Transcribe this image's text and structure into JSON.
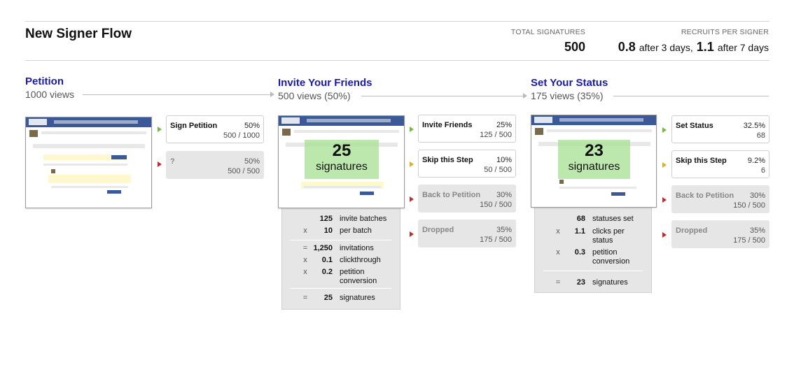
{
  "header": {
    "title": "New Signer Flow",
    "total_signatures_label": "TOTAL SIGNATURES",
    "total_signatures_value": "500",
    "recruits_label": "RECRUITS PER SIGNER",
    "recruits_3d_value": "0.8",
    "recruits_3d_text": "after 3 days,",
    "recruits_7d_value": "1.1",
    "recruits_7d_text": "after 7 days"
  },
  "stages": [
    {
      "title": "Petition",
      "views": "1000 views",
      "options": [
        {
          "label": "Sign Petition",
          "pct": "50%",
          "frac": "500 / 1000",
          "state": "green"
        },
        {
          "label": "?",
          "pct": "50%",
          "frac": "500 / 500",
          "state": "red"
        }
      ]
    },
    {
      "title": "Invite Your Friends",
      "views": "500 views (50%)",
      "overlay_num": "25",
      "overlay_label": "signatures",
      "options": [
        {
          "label": "Invite Friends",
          "pct": "25%",
          "frac": "125 / 500",
          "state": "green"
        },
        {
          "label": "Skip this Step",
          "pct": "10%",
          "frac": "50 / 500",
          "state": "yellow"
        },
        {
          "label": "Back to Petition",
          "pct": "30%",
          "frac": "150 / 500",
          "state": "red"
        },
        {
          "label": "Dropped",
          "pct": "35%",
          "frac": "175 / 500",
          "state": "red"
        }
      ],
      "calc": [
        {
          "op": "",
          "val": "125",
          "desc": "invite batches"
        },
        {
          "op": "x",
          "val": "10",
          "desc": "per batch"
        },
        {
          "op": "=",
          "val": "1,250",
          "desc": "invitations"
        },
        {
          "op": "x",
          "val": "0.1",
          "desc": "clickthrough"
        },
        {
          "op": "x",
          "val": "0.2",
          "desc": "petition conversion"
        },
        {
          "op": "=",
          "val": "25",
          "desc": "signatures"
        }
      ]
    },
    {
      "title": "Set Your Status",
      "views": "175 views (35%)",
      "overlay_num": "23",
      "overlay_label": "signatures",
      "options": [
        {
          "label": "Set Status",
          "pct": "32.5%",
          "frac": "68",
          "state": "green"
        },
        {
          "label": "Skip this Step",
          "pct": "9.2%",
          "frac": "6",
          "state": "yellow"
        },
        {
          "label": "Back to Petition",
          "pct": "30%",
          "frac": "150 / 500",
          "state": "red"
        },
        {
          "label": "Dropped",
          "pct": "35%",
          "frac": "175 / 500",
          "state": "red"
        }
      ],
      "calc": [
        {
          "op": "",
          "val": "68",
          "desc": "statuses set"
        },
        {
          "op": "x",
          "val": "1.1",
          "desc": "clicks per status"
        },
        {
          "op": "x",
          "val": "0.3",
          "desc": "petition conversion"
        },
        {
          "op": "=",
          "val": "23",
          "desc": "signatures"
        }
      ]
    }
  ]
}
